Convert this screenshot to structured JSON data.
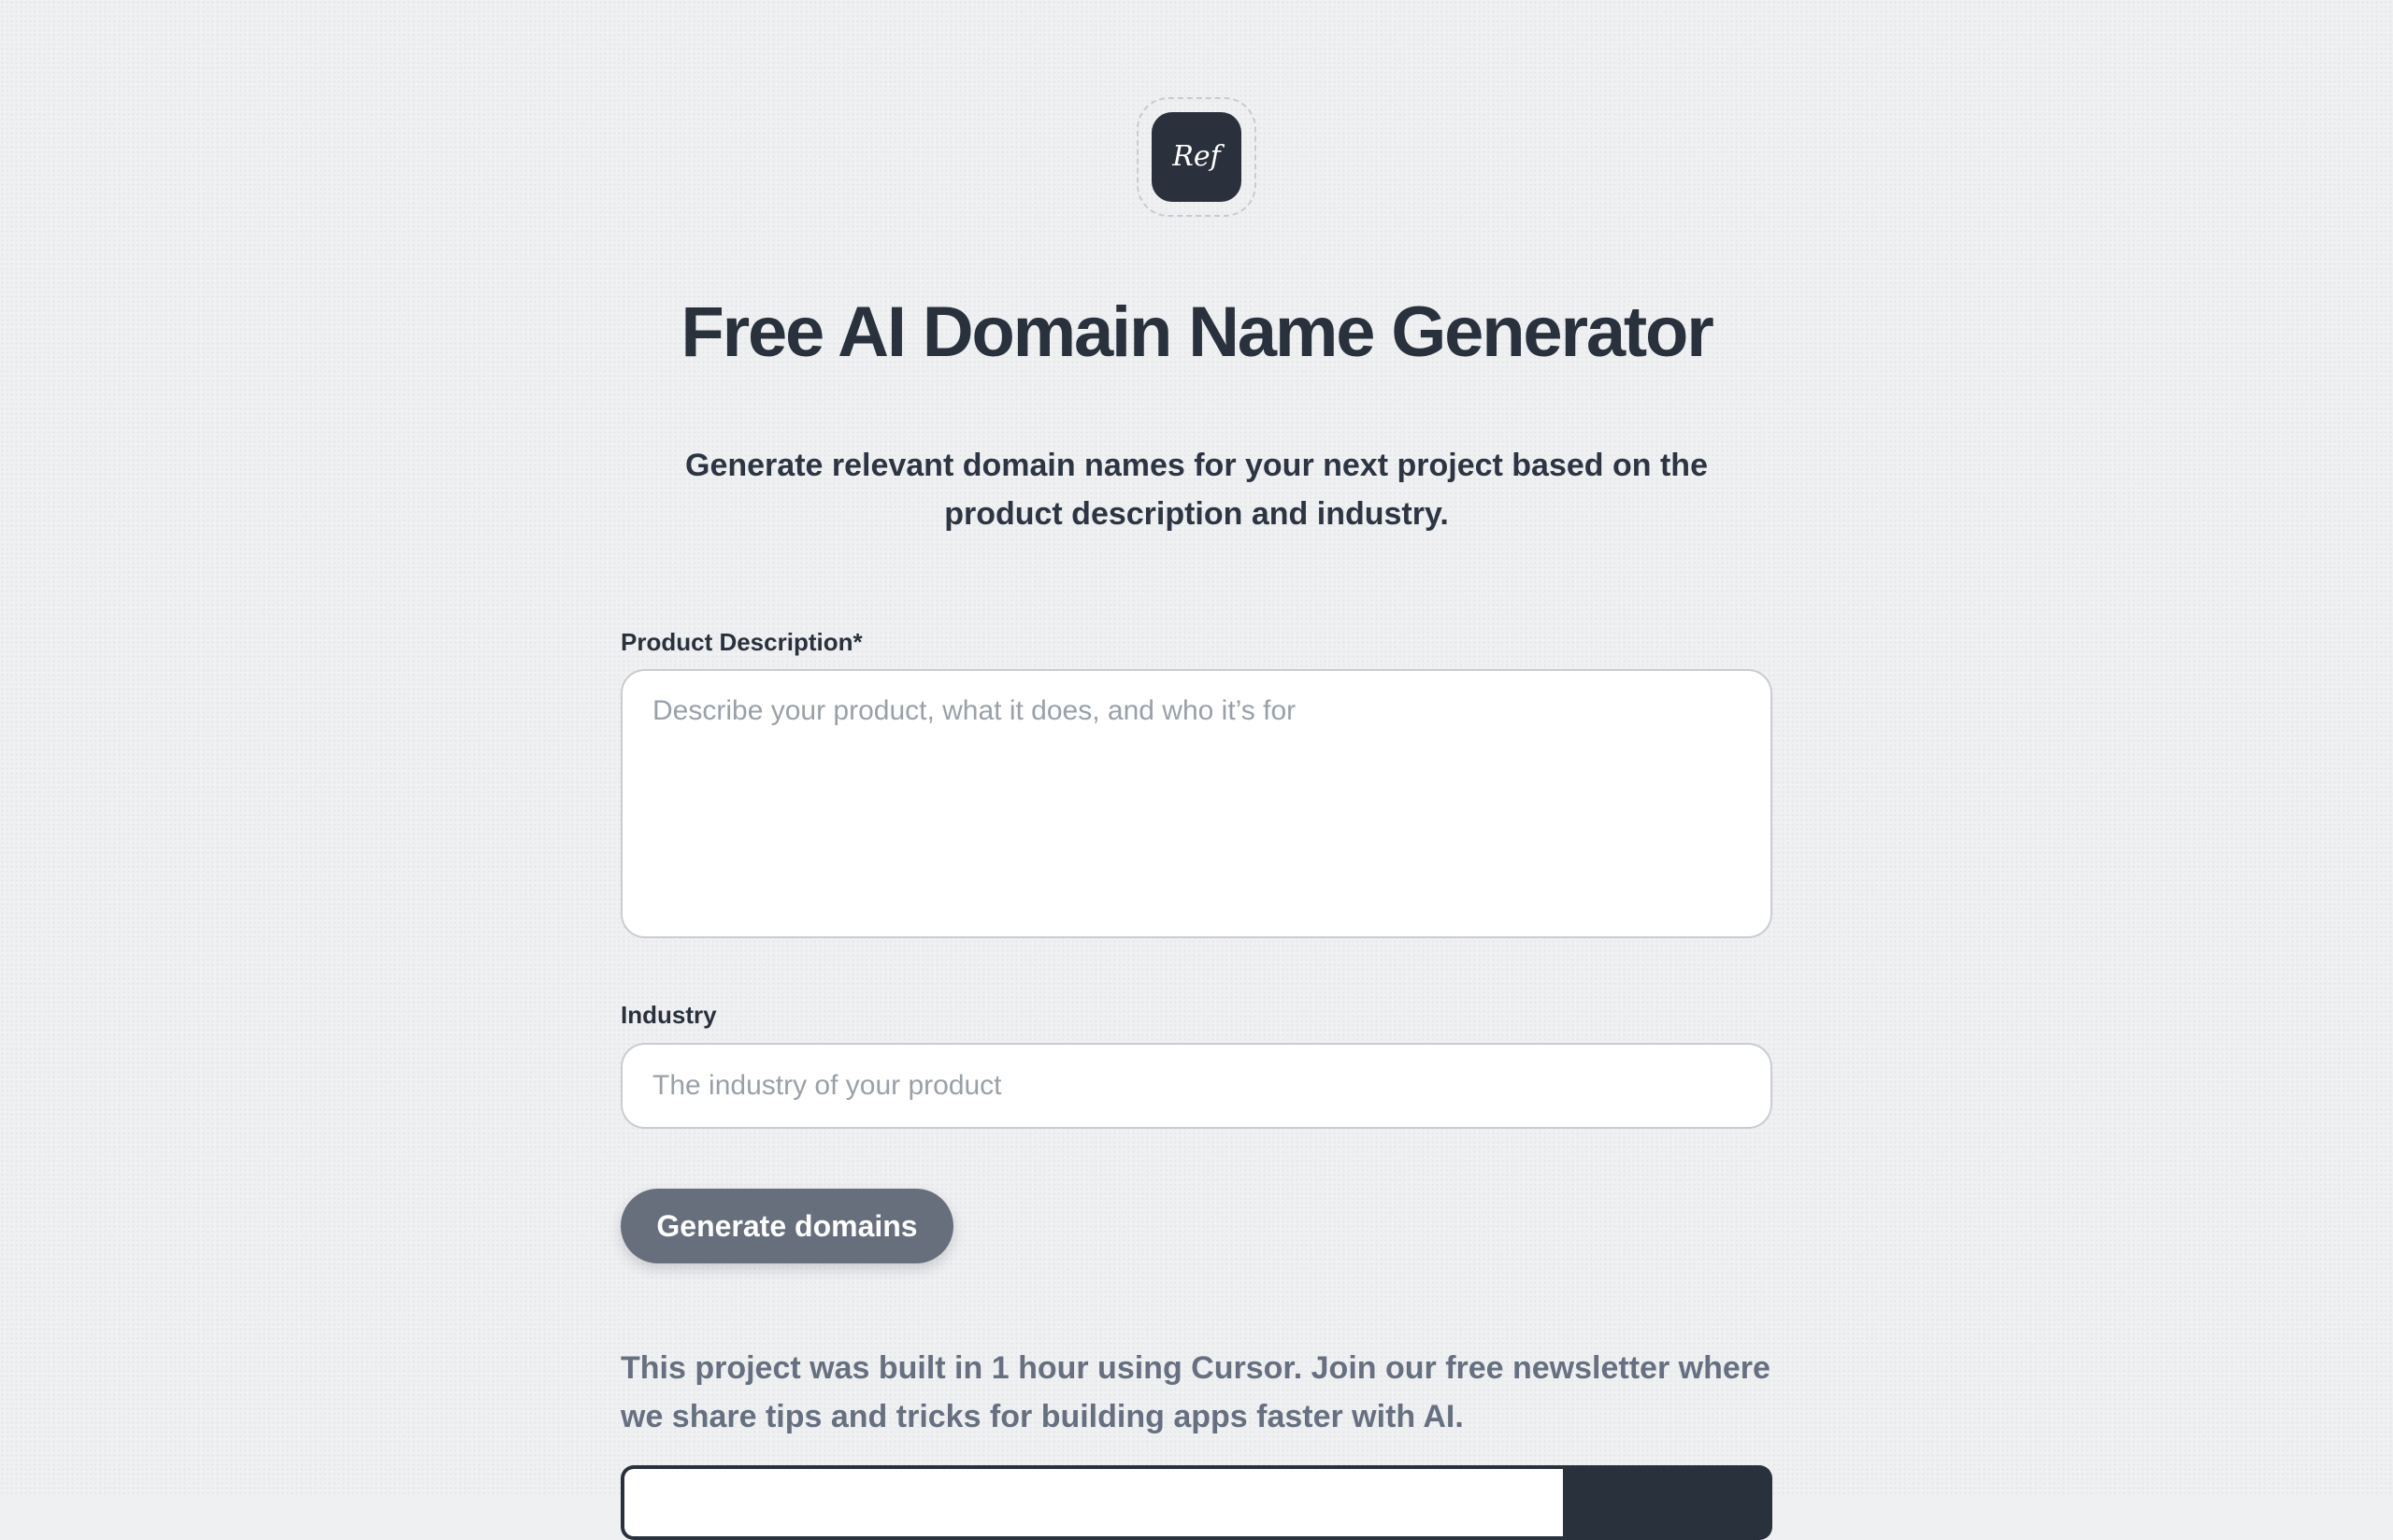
{
  "logo": {
    "text": "Ref",
    "icon": "ref-logo-icon",
    "background": "#2b313c"
  },
  "header": {
    "title": "Free AI Domain Name Generator",
    "subtitle": "Generate relevant domain names for your next project based on the product description and industry."
  },
  "form": {
    "description_label": "Product Description*",
    "description_placeholder": "Describe your product, what it does, and who it’s for",
    "description_value": "",
    "industry_label": "Industry",
    "industry_placeholder": "The industry of your product",
    "industry_value": "",
    "submit_label": "Generate domains"
  },
  "newsletter": {
    "text": "This project was built in 1 hour using Cursor. Join our free newsletter where we share tips and tricks for building apps faster with AI.",
    "email_value": ""
  },
  "colors": {
    "background": "#eff0f2",
    "text_dark": "#29313d",
    "text_muted": "#667080",
    "button": "#676f7c",
    "placeholder": "#9aa0a9",
    "border": "#c9ccd2"
  }
}
